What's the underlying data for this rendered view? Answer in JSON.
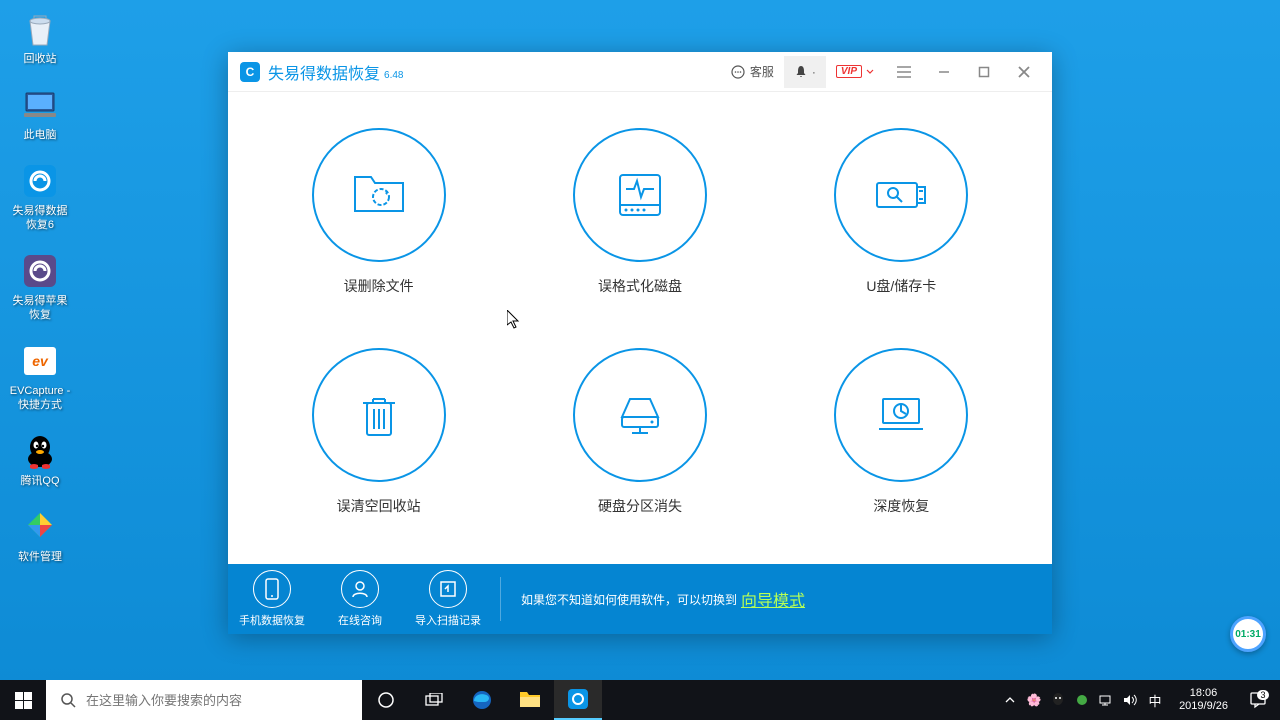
{
  "desktop": {
    "icons": [
      {
        "label": "回收站"
      },
      {
        "label": "此电脑"
      },
      {
        "label": "失易得数据恢复6"
      },
      {
        "label": "失易得苹果恢复"
      },
      {
        "label": "EVCapture - 快捷方式"
      },
      {
        "label": "腾讯QQ"
      },
      {
        "label": "软件管理"
      }
    ]
  },
  "app": {
    "title": "失易得数据恢复",
    "version": "6.48",
    "titlebar": {
      "service": "客服",
      "bell": "·",
      "vip": "VIP"
    },
    "options": [
      {
        "label": "误删除文件"
      },
      {
        "label": "误格式化磁盘"
      },
      {
        "label": "U盘/储存卡"
      },
      {
        "label": "误清空回收站"
      },
      {
        "label": "硬盘分区消失"
      },
      {
        "label": "深度恢复"
      }
    ],
    "footer": {
      "buttons": [
        {
          "label": "手机数据恢复"
        },
        {
          "label": "在线咨询"
        },
        {
          "label": "导入扫描记录"
        }
      ],
      "msg": "如果您不知道如何使用软件，可以切换到",
      "link": "向导模式"
    }
  },
  "float": {
    "badge": "01:31"
  },
  "taskbar": {
    "search_placeholder": "在这里输入你要搜索的内容",
    "clock": {
      "time": "18:06",
      "date": "2019/9/26"
    },
    "ime": "中",
    "notif_count": "3"
  }
}
